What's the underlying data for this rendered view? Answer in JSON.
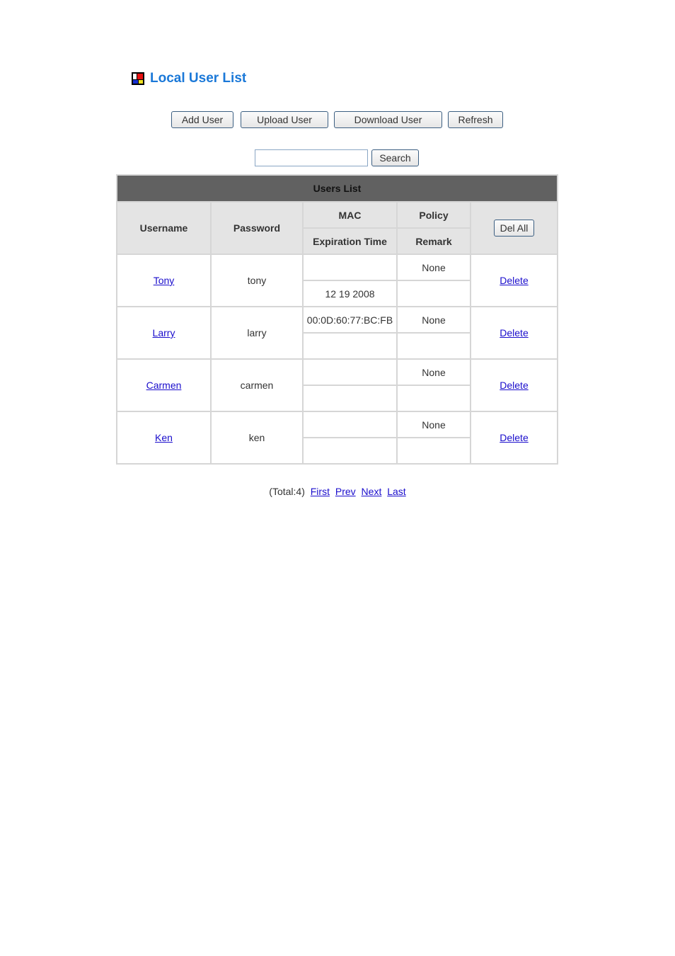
{
  "page": {
    "title": "Local User List",
    "icon": "user-list-icon"
  },
  "toolbar": {
    "add_user": "Add User",
    "upload_user": "Upload User",
    "download_user": "Download User",
    "refresh": "Refresh"
  },
  "search": {
    "value": "",
    "placeholder": "",
    "button": "Search"
  },
  "table": {
    "caption": "Users List",
    "headers": {
      "username": "Username",
      "password": "Password",
      "mac": "MAC",
      "policy": "Policy",
      "expiration": "Expiration Time",
      "remark": "Remark",
      "del_all": "Del All"
    },
    "rows": [
      {
        "username": "Tony",
        "password": "tony",
        "mac": "",
        "policy": "None",
        "expiration": "12 19 2008",
        "remark": "",
        "action": "Delete"
      },
      {
        "username": "Larry",
        "password": "larry",
        "mac": "00:0D:60:77:BC:FB",
        "policy": "None",
        "expiration": "",
        "remark": "",
        "action": "Delete"
      },
      {
        "username": "Carmen",
        "password": "carmen",
        "mac": "",
        "policy": "None",
        "expiration": "",
        "remark": "",
        "action": "Delete"
      },
      {
        "username": "Ken",
        "password": "ken",
        "mac": "",
        "policy": "None",
        "expiration": "",
        "remark": "",
        "action": "Delete"
      }
    ]
  },
  "pager": {
    "total": "(Total:4)",
    "first": "First",
    "prev": "Prev",
    "next": "Next",
    "last": "Last"
  }
}
